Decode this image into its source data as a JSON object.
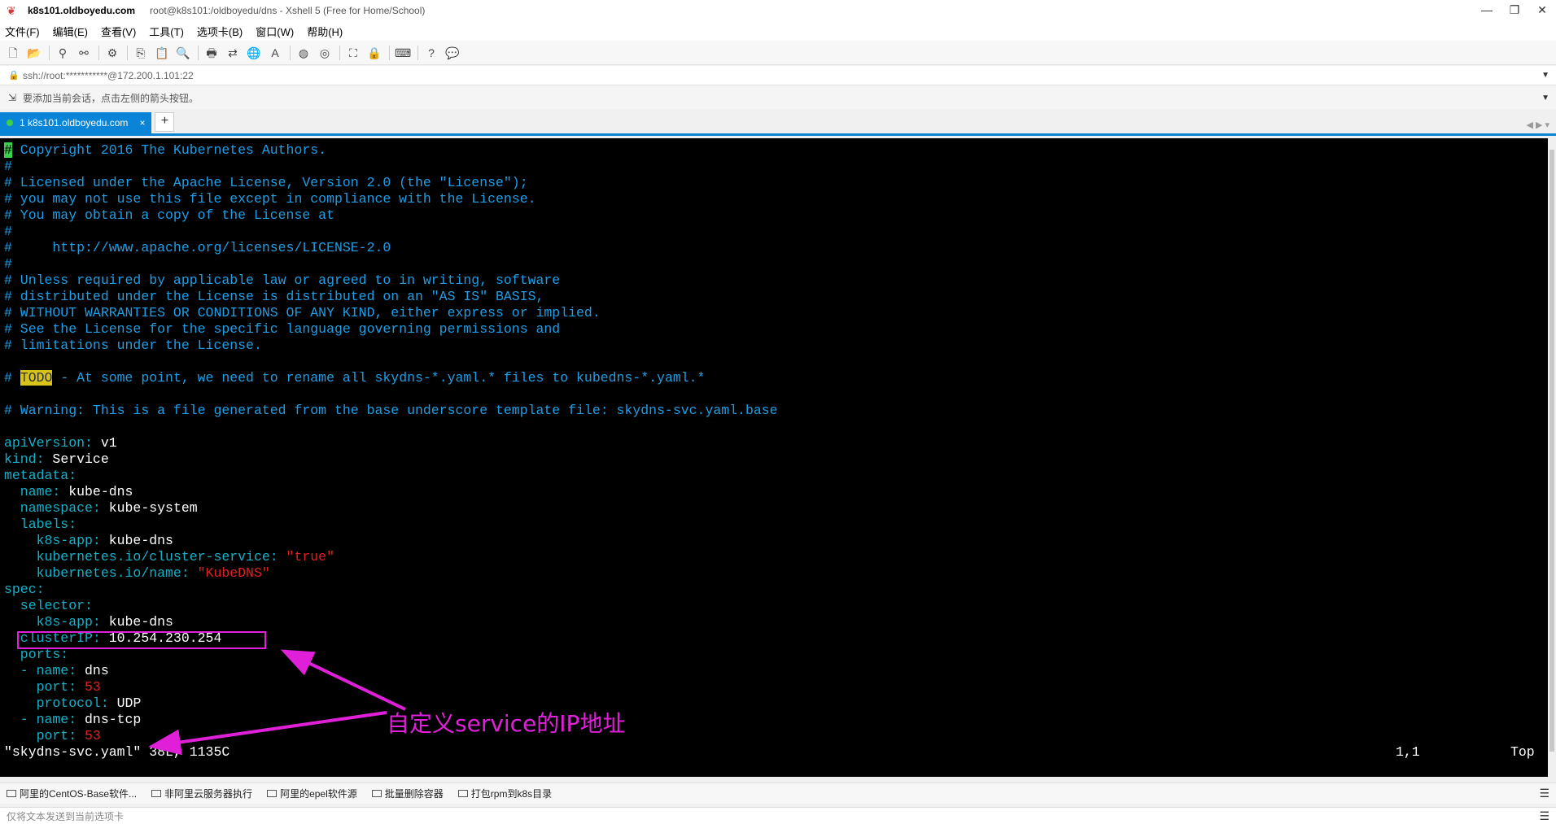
{
  "window": {
    "host": "k8s101.oldboyedu.com",
    "subtitle": "root@k8s101:/oldboyedu/dns - Xshell 5 (Free for Home/School)",
    "min": "—",
    "restore": "❐",
    "close": "✕"
  },
  "menu": [
    "文件(F)",
    "编辑(E)",
    "查看(V)",
    "工具(T)",
    "选项卡(B)",
    "窗口(W)",
    "帮助(H)"
  ],
  "address": {
    "text": "ssh://root:***********@172.200.1.101:22"
  },
  "hint": "要添加当前会话，点击左侧的箭头按钮。",
  "tab": {
    "label": "1 k8s101.oldboyedu.com",
    "close": "×",
    "add": "+"
  },
  "terminal": {
    "lines": [
      [
        [
          "cursor",
          "#"
        ],
        [
          "c",
          " Copyright 2016 The Kubernetes Authors."
        ]
      ],
      [
        [
          "c",
          "#"
        ]
      ],
      [
        [
          "c",
          "# Licensed under the Apache License, Version 2.0 (the \"License\");"
        ]
      ],
      [
        [
          "c",
          "# you may not use this file except in compliance with the License."
        ]
      ],
      [
        [
          "c",
          "# You may obtain a copy of the License at"
        ]
      ],
      [
        [
          "c",
          "#"
        ]
      ],
      [
        [
          "c",
          "#     http://www.apache.org/licenses/LICENSE-2.0"
        ]
      ],
      [
        [
          "c",
          "#"
        ]
      ],
      [
        [
          "c",
          "# Unless required by applicable law or agreed to in writing, software"
        ]
      ],
      [
        [
          "c",
          "# distributed under the License is distributed on an \"AS IS\" BASIS,"
        ]
      ],
      [
        [
          "c",
          "# WITHOUT WARRANTIES OR CONDITIONS OF ANY KIND, either express or implied."
        ]
      ],
      [
        [
          "c",
          "# See the License for the specific language governing permissions and"
        ]
      ],
      [
        [
          "c",
          "# limitations under the License."
        ]
      ],
      [
        [
          "w",
          ""
        ]
      ],
      [
        [
          "c",
          "# "
        ],
        [
          "todo",
          "TODO"
        ],
        [
          "c",
          " - At some point, we need to rename all skydns-*.yaml.* files to kubedns-*.yaml.*"
        ]
      ],
      [
        [
          "w",
          ""
        ]
      ],
      [
        [
          "c",
          "# Warning: This is a file generated from the base underscore template file: skydns-svc.yaml.base"
        ]
      ],
      [
        [
          "w",
          ""
        ]
      ],
      [
        [
          "k",
          "apiVersion:"
        ],
        [
          "w",
          " v1"
        ]
      ],
      [
        [
          "k",
          "kind:"
        ],
        [
          "w",
          " Service"
        ]
      ],
      [
        [
          "k",
          "metadata:"
        ]
      ],
      [
        [
          "k",
          "  name:"
        ],
        [
          "w",
          " kube-dns"
        ]
      ],
      [
        [
          "k",
          "  namespace:"
        ],
        [
          "w",
          " kube-system"
        ]
      ],
      [
        [
          "k",
          "  labels:"
        ]
      ],
      [
        [
          "k",
          "    k8s-app:"
        ],
        [
          "w",
          " kube-dns"
        ]
      ],
      [
        [
          "k",
          "    kubernetes.io/cluster-service:"
        ],
        [
          "s",
          " \"true\""
        ]
      ],
      [
        [
          "k",
          "    kubernetes.io/name:"
        ],
        [
          "s",
          " \"KubeDNS\""
        ]
      ],
      [
        [
          "k",
          "spec:"
        ]
      ],
      [
        [
          "k",
          "  selector:"
        ]
      ],
      [
        [
          "k",
          "    k8s-app:"
        ],
        [
          "w",
          " kube-dns"
        ]
      ],
      [
        [
          "k",
          "  clusterIP:"
        ],
        [
          "w",
          " 10.254.230.254"
        ]
      ],
      [
        [
          "k",
          "  ports:"
        ]
      ],
      [
        [
          "k",
          "  - name:"
        ],
        [
          "w",
          " dns"
        ]
      ],
      [
        [
          "k",
          "    port:"
        ],
        [
          "n",
          " 53"
        ]
      ],
      [
        [
          "k",
          "    protocol:"
        ],
        [
          "w",
          " UDP"
        ]
      ],
      [
        [
          "k",
          "  - name:"
        ],
        [
          "w",
          " dns-tcp"
        ]
      ],
      [
        [
          "k",
          "    port:"
        ],
        [
          "n",
          " 53"
        ]
      ]
    ],
    "status_file": "\"skydns-svc.yaml\" 38L, 1135C",
    "status_pos": "1,1",
    "status_top": "Top"
  },
  "annotation": {
    "text": "自定义service的IP地址",
    "color": "#e020d8"
  },
  "quick_commands": [
    "阿里的CentOS-Base软件...",
    "非阿里云服务器执行",
    "阿里的epel软件源",
    "批量删除容器",
    "打包rpm到k8s目录"
  ],
  "send_placeholder": "仅将文本发送到当前选项卡",
  "colors": {
    "tab_active": "#0a84d6",
    "terminal_bg": "#000000",
    "comment": "#1f9ee6",
    "key": "#17b0c7",
    "string": "#e02020"
  }
}
